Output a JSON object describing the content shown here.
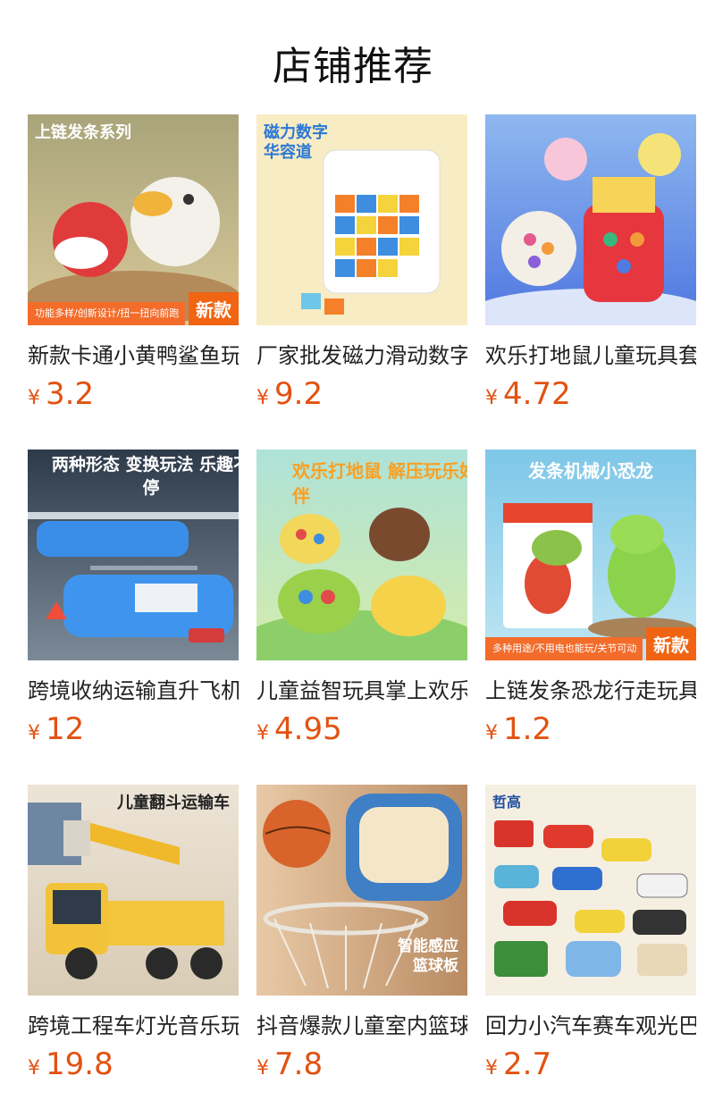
{
  "page_title": "店铺推荐",
  "currency_symbol": "¥",
  "products": [
    {
      "name": "新款卡通小黄鸭鲨鱼玩具",
      "price": "3.2",
      "banner": "上链发条系列",
      "sub": "功能多样/创新设计/扭一扭向前跑",
      "badge": "新款"
    },
    {
      "name": "厂家批发磁力滑动数字华容道",
      "price": "9.2",
      "banner": "磁力数字华容道"
    },
    {
      "name": "欢乐打地鼠儿童玩具套装",
      "price": "4.72"
    },
    {
      "name": "跨境收纳运输直升飞机玩具",
      "price": "12",
      "banner": "两种形态 变换玩法 乐趣不停"
    },
    {
      "name": "儿童益智玩具掌上欢乐打地鼠",
      "price": "4.95",
      "banner": "欢乐打地鼠 解压玩乐好伙伴"
    },
    {
      "name": "上链发条恐龙行走玩具",
      "price": "1.2",
      "banner": "发条机械小恐龙",
      "sub": "多种用途/不用电也能玩/关节可动",
      "badge": "新款"
    },
    {
      "name": "跨境工程车灯光音乐玩具",
      "price": "19.8",
      "banner": "儿童翻斗运输车"
    },
    {
      "name": "抖音爆款儿童室内篮球板",
      "price": "7.8",
      "banner": "智能感应篮球板"
    },
    {
      "name": "回力小汽车赛车观光巴士",
      "price": "2.7",
      "banner": "哲高"
    }
  ]
}
